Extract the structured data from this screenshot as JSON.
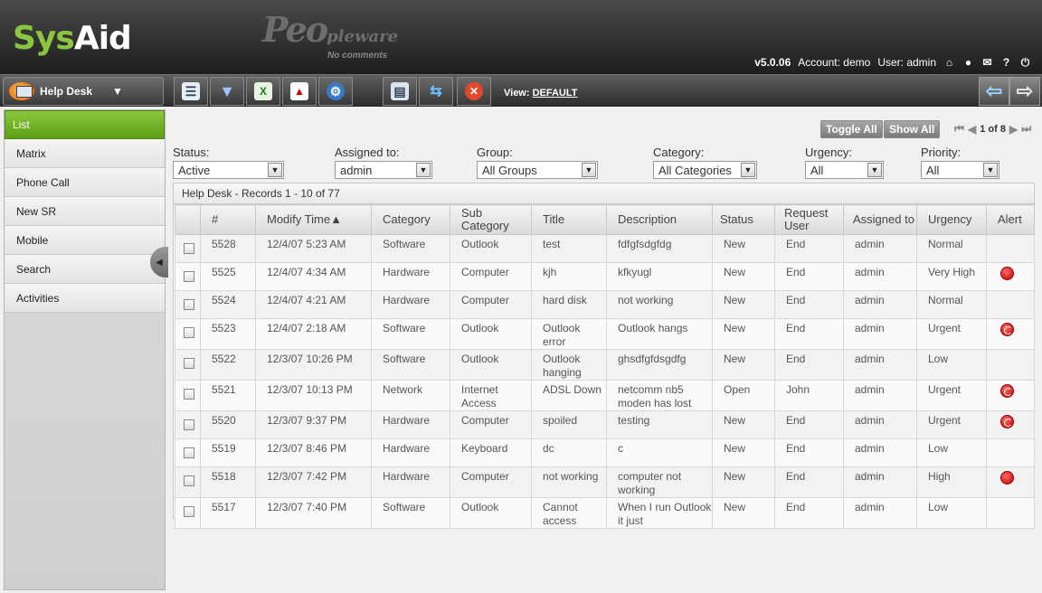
{
  "header": {
    "logo_part1": "Sys",
    "logo_part2": "Aid",
    "partner_logo_main": "Peo",
    "partner_logo_small": "pleware",
    "partner_tagline": "No comments",
    "version": "v5.0.06",
    "account": "Account: demo",
    "user": "User: admin",
    "icons": [
      "home-icon",
      "user-icon",
      "mail-icon",
      "help-icon",
      "logout-icon"
    ]
  },
  "toolbar": {
    "module_label": "Help Desk",
    "buttons": [
      "list-icon",
      "filter-icon",
      "excel-icon",
      "pdf-icon",
      "settings-icon",
      "print-icon",
      "swap-icon",
      "cancel-icon"
    ],
    "view_label": "View:",
    "view_value": "DEFAULT"
  },
  "sidebar": {
    "items": [
      {
        "label": "List",
        "active": true
      },
      {
        "label": "Matrix"
      },
      {
        "label": "Phone Call"
      },
      {
        "label": "New SR"
      },
      {
        "label": "Mobile"
      },
      {
        "label": "Search"
      },
      {
        "label": "Activities"
      }
    ]
  },
  "actions": {
    "toggle_all": "Toggle All",
    "show_all": "Show All",
    "page_info": "1 of 8"
  },
  "filters": {
    "status": {
      "label": "Status:",
      "value": "Active"
    },
    "assigned": {
      "label": "Assigned to:",
      "value": "admin"
    },
    "group": {
      "label": "Group:",
      "value": "All Groups"
    },
    "category": {
      "label": "Category:",
      "value": "All Categories"
    },
    "urgency": {
      "label": "Urgency:",
      "value": "All"
    },
    "priority": {
      "label": "Priority:",
      "value": "All"
    }
  },
  "grid": {
    "title": "Help Desk - Records 1 - 10 of 77",
    "columns": [
      "#",
      "Modify Time▲",
      "Category",
      "Sub Category",
      "Title",
      "Description",
      "Status",
      "Request User",
      "Assigned to",
      "Urgency",
      "Alert"
    ],
    "rows": [
      {
        "id": "5528",
        "time": "12/4/07 5:23 AM",
        "category": "Software",
        "sub": "Outlook",
        "title": "test",
        "desc": "fdfgfsdgfdg",
        "status": "New",
        "req": "End",
        "assigned": "admin",
        "urgency": "Normal",
        "alert": ""
      },
      {
        "id": "5525",
        "time": "12/4/07 4:34 AM",
        "category": "Hardware",
        "sub": "Computer",
        "title": "kjh",
        "desc": "kfkyugl",
        "status": "New",
        "req": "End",
        "assigned": "admin",
        "urgency": "Very High",
        "alert": "red"
      },
      {
        "id": "5524",
        "time": "12/4/07 4:21 AM",
        "category": "Hardware",
        "sub": "Computer",
        "title": "hard disk",
        "desc": "not working",
        "status": "New",
        "req": "End",
        "assigned": "admin",
        "urgency": "Normal",
        "alert": ""
      },
      {
        "id": "5523",
        "time": "12/4/07 2:18 AM",
        "category": "Software",
        "sub": "Outlook",
        "title": "Outlook error",
        "desc": "Outlook hangs",
        "status": "New",
        "req": "End",
        "assigned": "admin",
        "urgency": "Urgent",
        "alert": "cycle"
      },
      {
        "id": "5522",
        "time": "12/3/07 10:26 PM",
        "category": "Software",
        "sub": "Outlook",
        "title": "Outlook hanging",
        "desc": "ghsdfgfdsgdfg",
        "status": "New",
        "req": "End",
        "assigned": "admin",
        "urgency": "Low",
        "alert": ""
      },
      {
        "id": "5521",
        "time": "12/3/07 10:13 PM",
        "category": "Network",
        "sub": "Internet Access",
        "title": "ADSL Down",
        "desc": "netcomm nb5 moden has lost",
        "status": "Open",
        "req": "John",
        "assigned": "admin",
        "urgency": "Urgent",
        "alert": "cycle"
      },
      {
        "id": "5520",
        "time": "12/3/07 9:37 PM",
        "category": "Hardware",
        "sub": "Computer",
        "title": "spoiled",
        "desc": "testing",
        "status": "New",
        "req": "End",
        "assigned": "admin",
        "urgency": "Urgent",
        "alert": "cycle"
      },
      {
        "id": "5519",
        "time": "12/3/07 8:46 PM",
        "category": "Hardware",
        "sub": "Keyboard",
        "title": "dc",
        "desc": "c",
        "status": "New",
        "req": "End",
        "assigned": "admin",
        "urgency": "Low",
        "alert": ""
      },
      {
        "id": "5518",
        "time": "12/3/07 7:42 PM",
        "category": "Hardware",
        "sub": "Computer",
        "title": "not working",
        "desc": "computer not working",
        "status": "New",
        "req": "End",
        "assigned": "admin",
        "urgency": "High",
        "alert": "red"
      },
      {
        "id": "5517",
        "time": "12/3/07 7:40 PM",
        "category": "Software",
        "sub": "Outlook",
        "title": "Cannot access",
        "desc": "When I run Outlook it just",
        "status": "New",
        "req": "End",
        "assigned": "admin",
        "urgency": "Low",
        "alert": ""
      }
    ]
  },
  "colors": {
    "brand_green": "#8cc63f",
    "header_dark": "#1e1e1e",
    "alert_red": "#c00000"
  }
}
